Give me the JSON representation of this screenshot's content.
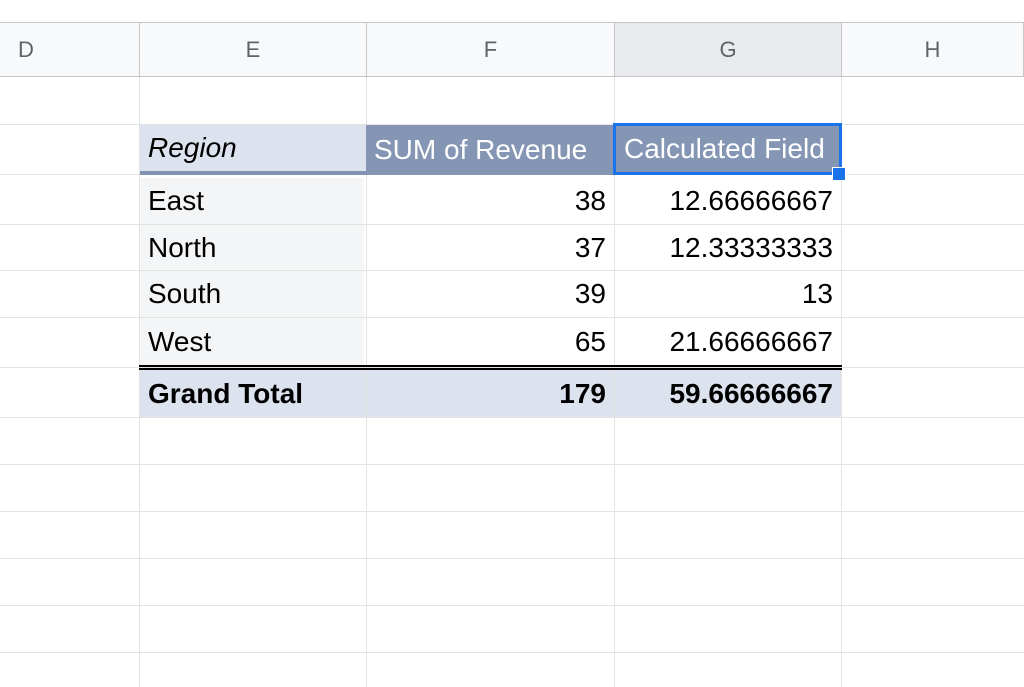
{
  "column_headers": [
    "D",
    "E",
    "F",
    "G",
    "H"
  ],
  "pivot": {
    "header_row_label": "Region",
    "value_headers": [
      "SUM of Revenue",
      "Calculated Field"
    ],
    "rows": [
      {
        "label": "East",
        "sum": "38",
        "calc": "12.66666667"
      },
      {
        "label": "North",
        "sum": "37",
        "calc": "12.33333333"
      },
      {
        "label": "South",
        "sum": "39",
        "calc": "13"
      },
      {
        "label": "West",
        "sum": "65",
        "calc": "21.66666667"
      }
    ],
    "grand_total": {
      "label": "Grand Total",
      "sum": "179",
      "calc": "59.66666667"
    }
  },
  "selection": {
    "active_column": "G",
    "selected_cell": "Calculated Field"
  },
  "colors": {
    "accent": "#1a73e8",
    "pivot_header": "#8596b5",
    "pivot_light": "#dde3ee"
  }
}
